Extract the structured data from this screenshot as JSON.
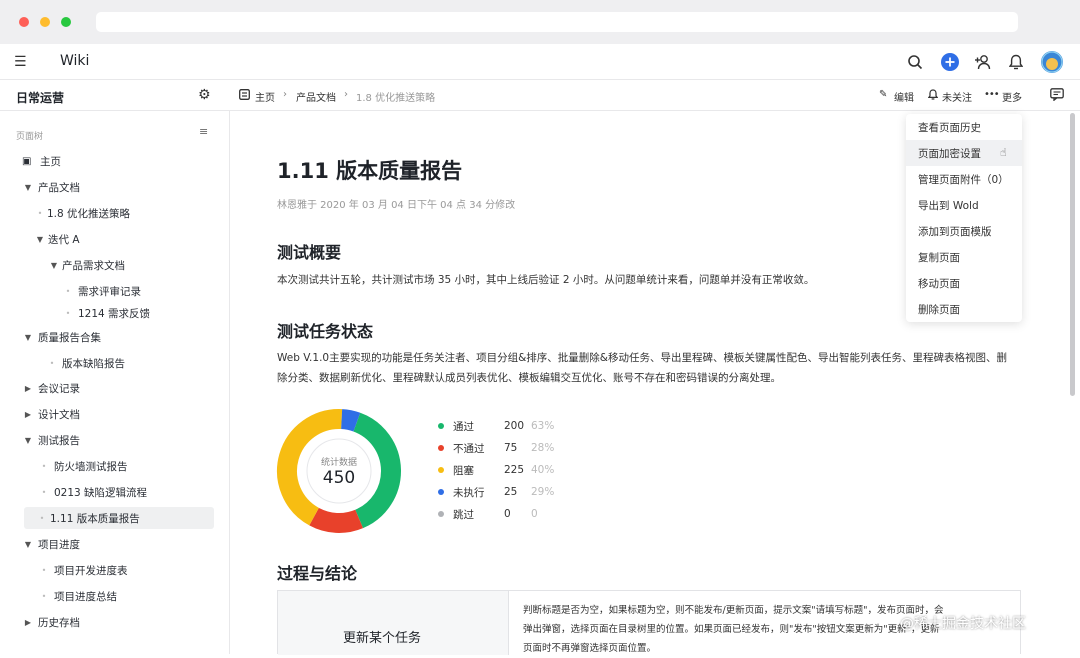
{
  "app": {
    "title": "Wiki"
  },
  "header": {
    "space_name": "日常运营"
  },
  "breadcrumb": {
    "home": "主页",
    "parent": "产品文档",
    "current": "1.8 优化推送策略"
  },
  "actions": {
    "edit": "编辑",
    "follow": "未关注",
    "more": "更多"
  },
  "sidebar": {
    "tree_label": "页面树",
    "items": [
      {
        "label": "主页"
      },
      {
        "label": "产品文档"
      },
      {
        "label": "1.8 优化推送策略"
      },
      {
        "label": "迭代 A"
      },
      {
        "label": "产品需求文档"
      },
      {
        "label": "需求评审记录"
      },
      {
        "label": "1214 需求反馈"
      },
      {
        "label": "质量报告合集"
      },
      {
        "label": "版本缺陷报告"
      },
      {
        "label": "会议记录"
      },
      {
        "label": "设计文档"
      },
      {
        "label": "测试报告"
      },
      {
        "label": "防火墙测试报告"
      },
      {
        "label": "0213 缺陷逻辑流程"
      },
      {
        "label": "1.11 版本质量报告"
      },
      {
        "label": "项目进度"
      },
      {
        "label": "项目开发进度表"
      },
      {
        "label": "项目进度总结"
      },
      {
        "label": "历史存档"
      }
    ]
  },
  "page": {
    "title": "1.11 版本质量报告",
    "meta": "林恩雅于 2020 年 03 月 04 日下午 04 点 34 分修改",
    "section1_title": "测试概要",
    "section1_text": "本次测试共计五轮，共计测试市场 35 小时，其中上线后验证 2 小时。从问题单统计来看，问题单并没有正常收敛。",
    "section2_title": "测试任务状态",
    "section2_line1": "Web V.1.0主要实现的功能是任务关注者、项目分组&排序、批量删除&移动任务、导出里程碑、模板关键属性配色、导出智能列表任务、里程碑表格视图、删",
    "section2_line2": "除分类、数据刷新优化、里程碑默认成员列表优化、模板编辑交互优化、账号不存在和密码错误的分离处理。",
    "section3_title": "过程与结论",
    "table_cell1": "更新某个任务",
    "table_cell2_line1": "判断标题是否为空，如果标题为空，则不能发布/更新页面，提示文案\"请填写标题\"，发布页面时，会",
    "table_cell2_line2": "弹出弹窗，选择页面在目录树里的位置。如果页面已经发布，则\"发布\"按钮文案更新为\"更新\"，更新",
    "table_cell2_line3": "页面时不再弹窗选择页面位置。"
  },
  "chart_data": {
    "type": "pie",
    "center_label": "统计数据",
    "total": "450",
    "series": [
      {
        "name": "通过",
        "value": "200",
        "percent": "63%",
        "color": "#18b76c"
      },
      {
        "name": "不通过",
        "value": "75",
        "percent": "28%",
        "color": "#e8412b"
      },
      {
        "name": "阻塞",
        "value": "225",
        "percent": "40%",
        "color": "#f7bd12"
      },
      {
        "name": "未执行",
        "value": "25",
        "percent": "29%",
        "color": "#2f6ee6"
      },
      {
        "name": "跳过",
        "value": "0",
        "percent": "0",
        "color": "#b0b2b6"
      }
    ]
  },
  "dropdown": {
    "items": [
      {
        "label": "查看页面历史"
      },
      {
        "label": "页面加密设置"
      },
      {
        "label": "管理页面附件（0）"
      },
      {
        "label": "导出到 Wold"
      },
      {
        "label": "添加到页面模版"
      },
      {
        "label": "复制页面"
      },
      {
        "label": "移动页面"
      },
      {
        "label": "删除页面"
      }
    ]
  },
  "watermark": "@稀土掘金技术社区"
}
